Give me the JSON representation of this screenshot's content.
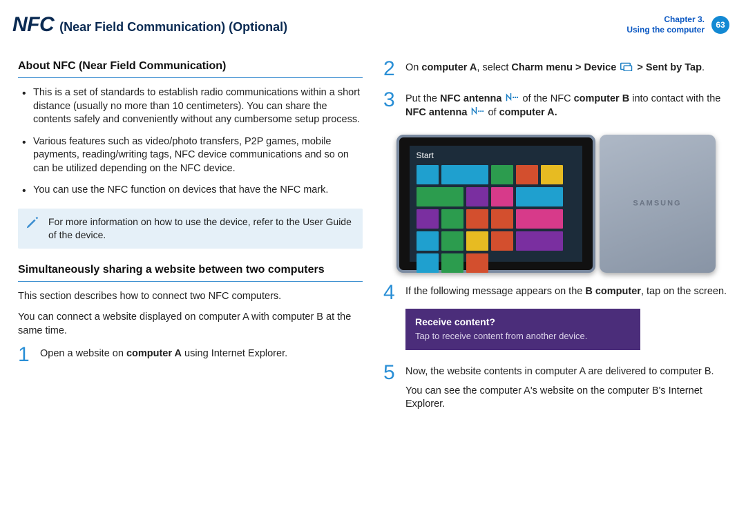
{
  "header": {
    "title_big": "NFC",
    "title_small": "(Near Field Communication) (Optional)",
    "chapter_line1": "Chapter 3.",
    "chapter_line2": "Using the computer",
    "page_number": "63"
  },
  "left": {
    "about_title": "About NFC (Near Field Communication)",
    "bullets": [
      "This is a set of standards to establish radio communications within a short distance (usually no more than 10 centimeters). You can share the contents safely and conveniently without any cumbersome setup process.",
      "Various features such as video/photo transfers, P2P games, mobile payments, reading/writing tags, NFC device communications and so on can be utilized depending on the NFC device.",
      "You can use the NFC function on devices that have the NFC mark."
    ],
    "note_text": "For more information on how to use the device, refer to the User Guide of the device.",
    "share_title": "Simultaneously sharing a website between two computers",
    "share_intro1": "This section describes how to connect two NFC computers.",
    "share_intro2": "You can connect a website displayed on computer A with computer B at the same time.",
    "step1": {
      "num": "1",
      "pre": "Open a website on ",
      "bold": "computer A",
      "post": " using Internet Explorer."
    }
  },
  "right": {
    "step2": {
      "num": "2",
      "p1": "On ",
      "p2_bold": "computer A",
      "p3": ", select ",
      "p4_bold": "Charm menu > Device ",
      "icon": "device-icon",
      "p5_bold": " > Sent by Tap",
      "p6": "."
    },
    "step3": {
      "num": "3",
      "p1": "Put the ",
      "p2_bold": "NFC antenna ",
      "icon1": "nfc-icon",
      "p3": " of the NFC ",
      "p4_bold": "computer B",
      "p5": " into contact with the ",
      "p6_bold": "NFC antenna ",
      "icon2": "nfc-icon",
      "p7": " of ",
      "p8_bold": "computer A."
    },
    "tablet_start_label": "Start",
    "tile_colors": [
      "#1fa0cf",
      "#1fa0cf",
      "#2c9c4e",
      "#d34f2e",
      "#e7bb22",
      "#2c9c4e",
      "#7a2fa0",
      "#d73a8a",
      "#1fa0cf",
      "#7a2fa0",
      "#2c9c4e",
      "#d34f2e",
      "#d34f2e",
      "#d73a8a",
      "#1fa0cf",
      "#2c9c4e",
      "#e7bb22",
      "#d34f2e",
      "#7a2fa0",
      "#1fa0cf",
      "#2c9c4e",
      "#d34f2e"
    ],
    "step4": {
      "num": "4",
      "p1": "If the following message appears on the ",
      "p2_bold": "B computer",
      "p3": ", tap on the screen."
    },
    "receive_title": "Receive content?",
    "receive_body": "Tap to receive content from another device.",
    "step5": {
      "num": "5",
      "p1": "Now, the website contents in computer A are delivered to computer B.",
      "p2": "You can see the computer A's website on the computer B's Internet Explorer."
    }
  }
}
